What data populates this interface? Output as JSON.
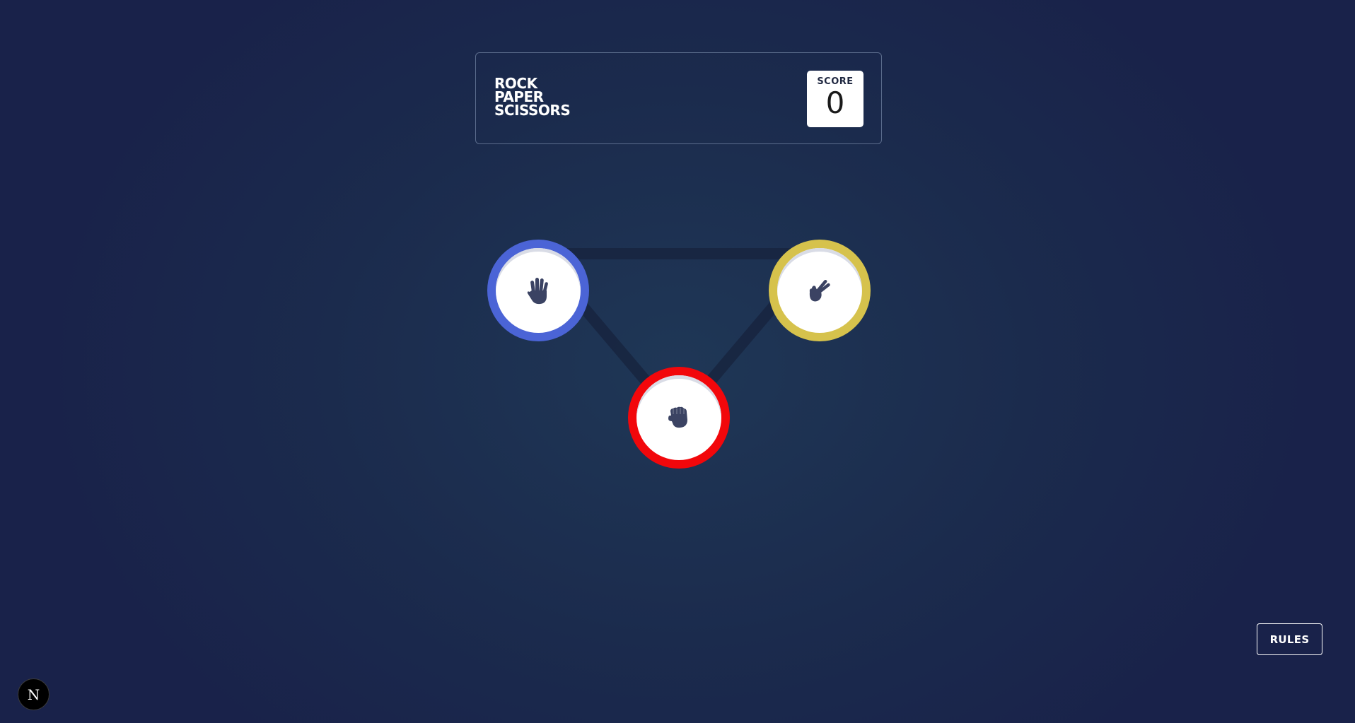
{
  "header": {
    "title_lines": [
      "ROCK",
      "PAPER",
      "SCISSORS"
    ],
    "score_label": "SCORE",
    "score_value": "0"
  },
  "tokens": [
    {
      "name": "paper",
      "icon": "hand-paper-icon",
      "ring_color": "#4b64d6"
    },
    {
      "name": "scissors",
      "icon": "hand-scissors-icon",
      "ring_color": "#d6c24c"
    },
    {
      "name": "rock",
      "icon": "hand-rock-icon",
      "ring_color": "#f2070b"
    }
  ],
  "rules_button": {
    "label": "RULES"
  },
  "dev_badge": {
    "label": "N",
    "icon": "nextjs-logo-icon"
  },
  "colors": {
    "background": "#1b2b4d",
    "triangle_line": "#17243f",
    "icon_fill": "#3b4363"
  }
}
